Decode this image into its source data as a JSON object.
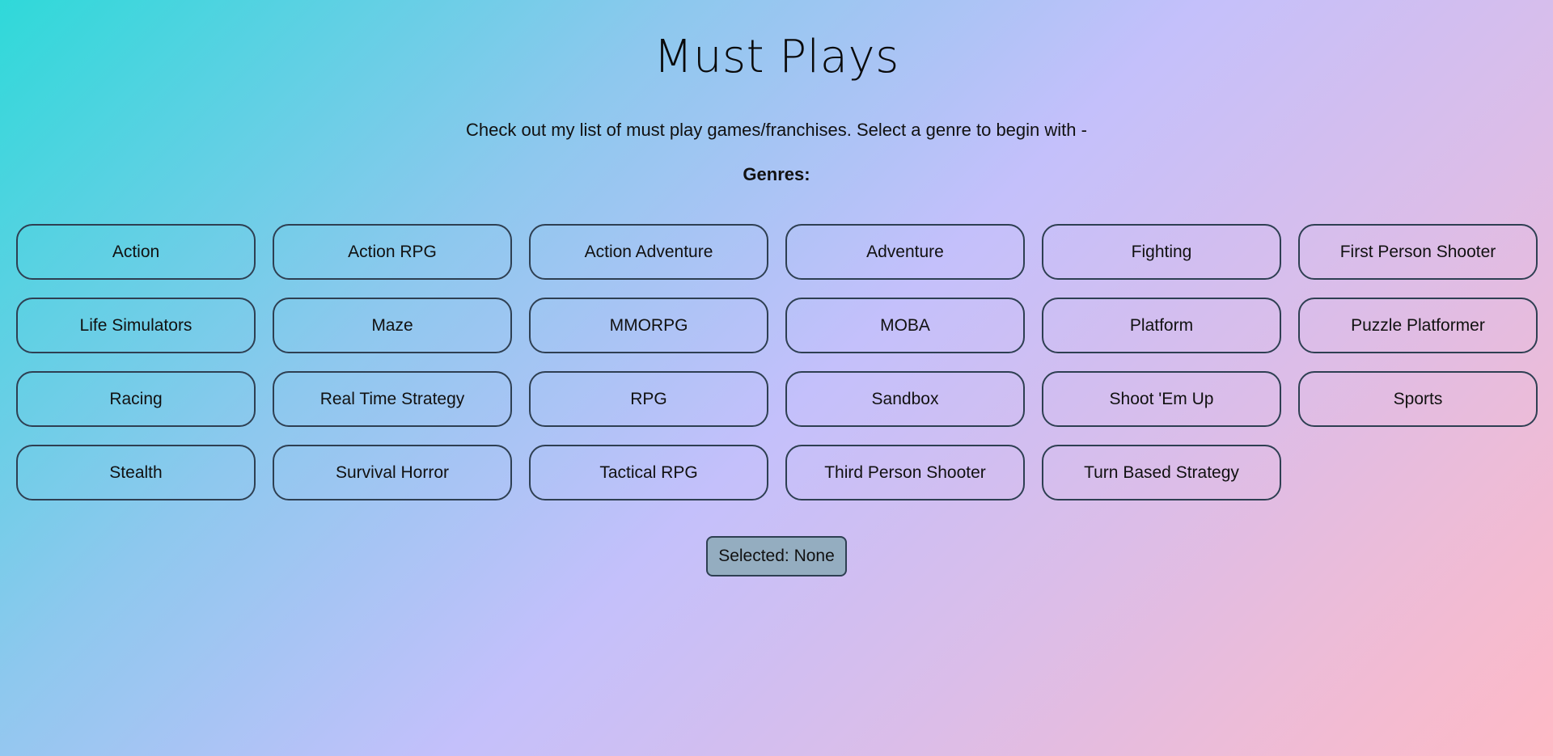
{
  "header": {
    "title": "Must Plays",
    "subtitle": "Check out my list of must play games/franchises. Select a genre to begin with -",
    "genres_label": "Genres:"
  },
  "genres": [
    {
      "label": "Action"
    },
    {
      "label": "Action RPG"
    },
    {
      "label": "Action Adventure"
    },
    {
      "label": "Adventure"
    },
    {
      "label": "Fighting"
    },
    {
      "label": "First Person Shooter"
    },
    {
      "label": "Life Simulators"
    },
    {
      "label": "Maze"
    },
    {
      "label": "MMORPG"
    },
    {
      "label": "MOBA"
    },
    {
      "label": "Platform"
    },
    {
      "label": "Puzzle Platformer"
    },
    {
      "label": "Racing"
    },
    {
      "label": "Real Time Strategy"
    },
    {
      "label": "RPG"
    },
    {
      "label": "Sandbox"
    },
    {
      "label": "Shoot 'Em Up"
    },
    {
      "label": "Sports"
    },
    {
      "label": "Stealth"
    },
    {
      "label": "Survival Horror"
    },
    {
      "label": "Tactical RPG"
    },
    {
      "label": "Third Person Shooter"
    },
    {
      "label": "Turn Based Strategy"
    }
  ],
  "selection": {
    "text": "Selected: None"
  },
  "colors": {
    "gradient_start": "#2fd9d9",
    "gradient_mid": "#c4c0fb",
    "gradient_end": "#ffbac6",
    "button_border": "#2e3f52",
    "selected_bg": "#94adc0"
  }
}
